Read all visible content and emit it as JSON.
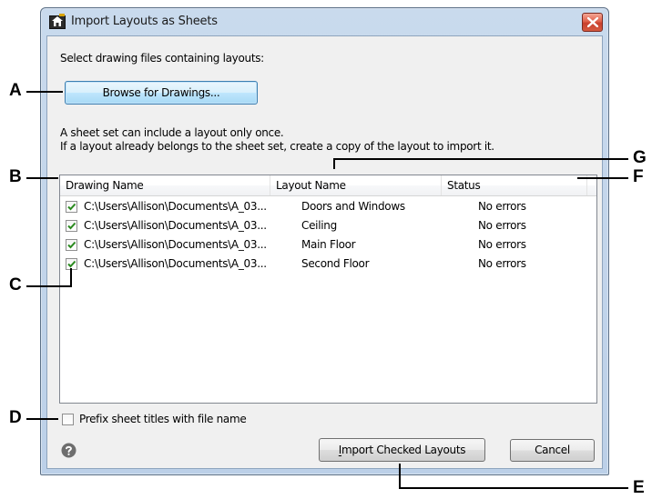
{
  "window": {
    "title": "Import Layouts as Sheets"
  },
  "dialog": {
    "select_label": "Select drawing files containing layouts:",
    "browse_button": "Browse for Drawings...",
    "info_line1": "A sheet set can include a layout only once.",
    "info_line2": "If a layout already belongs to the sheet set, create a copy of the layout to import it.",
    "prefix_checkbox_label": "Prefix sheet titles with file name",
    "prefix_checked": false,
    "import_button": "Import Checked Layouts",
    "cancel_button": "Cancel"
  },
  "list": {
    "columns": [
      "Drawing Name",
      "Layout Name",
      "Status"
    ],
    "rows": [
      {
        "drawing": "C:\\Users\\Allison\\Documents\\A_03...",
        "layout": "Doors and Windows",
        "status": "No errors",
        "checked": true
      },
      {
        "drawing": "C:\\Users\\Allison\\Documents\\A_03...",
        "layout": "Ceiling",
        "status": "No errors",
        "checked": true
      },
      {
        "drawing": "C:\\Users\\Allison\\Documents\\A_03...",
        "layout": "Main Floor",
        "status": "No errors",
        "checked": true
      },
      {
        "drawing": "C:\\Users\\Allison\\Documents\\A_03...",
        "layout": "Second Floor",
        "status": "No errors",
        "checked": true
      }
    ]
  },
  "callouts": {
    "a": "A",
    "b": "B",
    "c": "C",
    "d": "D",
    "e": "E",
    "f": "F",
    "g": "G"
  },
  "icons": {
    "app": "sheet-set-icon",
    "close": "close-icon",
    "help": "help-icon",
    "check": "checkmark-icon"
  },
  "colors": {
    "checkmark": "#2a8a1e",
    "close_button": "#d5503a",
    "title_bar": "#c4d7ec"
  }
}
